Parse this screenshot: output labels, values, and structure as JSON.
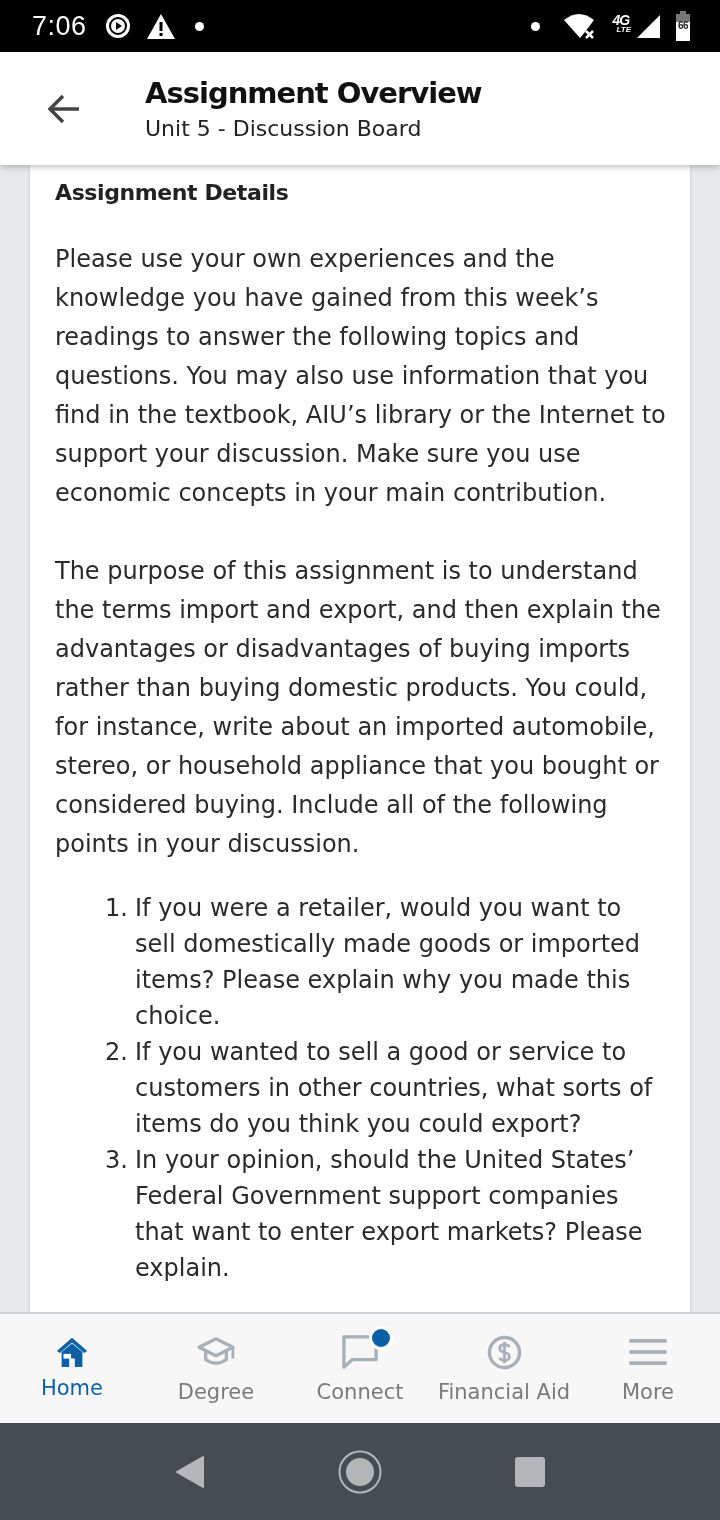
{
  "status_bar": {
    "time": "7:06",
    "network_type": "4G",
    "network_sub": "LTE",
    "battery": "66"
  },
  "header": {
    "title": "Assignment Overview",
    "subtitle": "Unit 5 - Discussion Board"
  },
  "details": {
    "heading": "Assignment Details",
    "paragraphs": [
      "Please use your own experiences and the knowledge you have gained from this week’s readings to answer the following topics and questions.  You may also use information that you find in the textbook, AIU’s library or the Internet to support your discussion. Make sure you use economic concepts in your main contribution.",
      "The purpose of this assignment is to understand the terms import and export, and then explain the advantages or disadvantages of buying imports rather than buying domestic products. You could, for instance, write about an imported automobile, stereo, or household appliance that you bought or considered buying. Include all of the following points in your discussion."
    ],
    "list": [
      {
        "number": "1.",
        "text": "If you were a retailer, would you want to sell domestically made goods or imported items? Please explain why you made this choice."
      },
      {
        "number": "2.",
        "text": "If you wanted to sell a good or service to customers in other countries, what sorts of items do you think you could export?"
      },
      {
        "number": "3.",
        "text": "In your opinion, should the United States’ Federal Government support companies that want to enter export markets? Please explain."
      }
    ]
  },
  "bottom_nav": [
    {
      "label": "Home",
      "selected": true,
      "notification": false
    },
    {
      "label": "Degree",
      "selected": false,
      "notification": false
    },
    {
      "label": "Connect",
      "selected": false,
      "notification": true
    },
    {
      "label": "Financial Aid",
      "selected": false,
      "notification": false
    },
    {
      "label": "More",
      "selected": false,
      "notification": false
    }
  ]
}
